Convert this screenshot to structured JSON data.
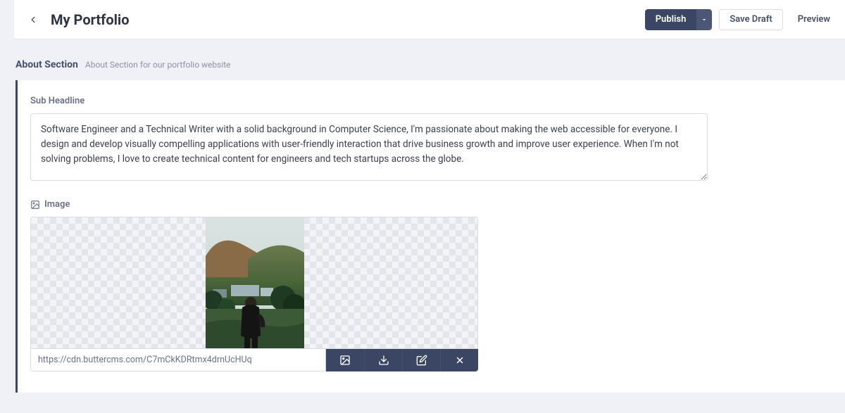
{
  "header": {
    "title": "My Portfolio",
    "actions": {
      "publish": "Publish",
      "save_draft": "Save Draft",
      "preview": "Preview"
    }
  },
  "section": {
    "title": "About Section",
    "description": "About Section for our portfolio website"
  },
  "fields": {
    "sub_headline": {
      "label": "Sub Headline",
      "value": "Software Engineer and a Technical Writer with a solid background in Computer Science, I'm passionate about making the web accessible for everyone. I design and develop visually compelling applications with user-friendly interaction that drive business growth and improve user experience. When I'm not solving problems, I love to create technical content for engineers and tech startups across the globe."
    },
    "image": {
      "label": "Image",
      "url": "https://cdn.buttercms.com/C7mCkKDRtmx4drnUcHUq"
    }
  },
  "image_tools": {
    "replace": "replace-image",
    "download": "download-image",
    "edit": "edit-image",
    "remove": "remove-image"
  },
  "colors": {
    "accent": "#3a4663",
    "bg": "#f0f1f7",
    "border": "#d9dce6",
    "muted": "#8b92a6"
  }
}
